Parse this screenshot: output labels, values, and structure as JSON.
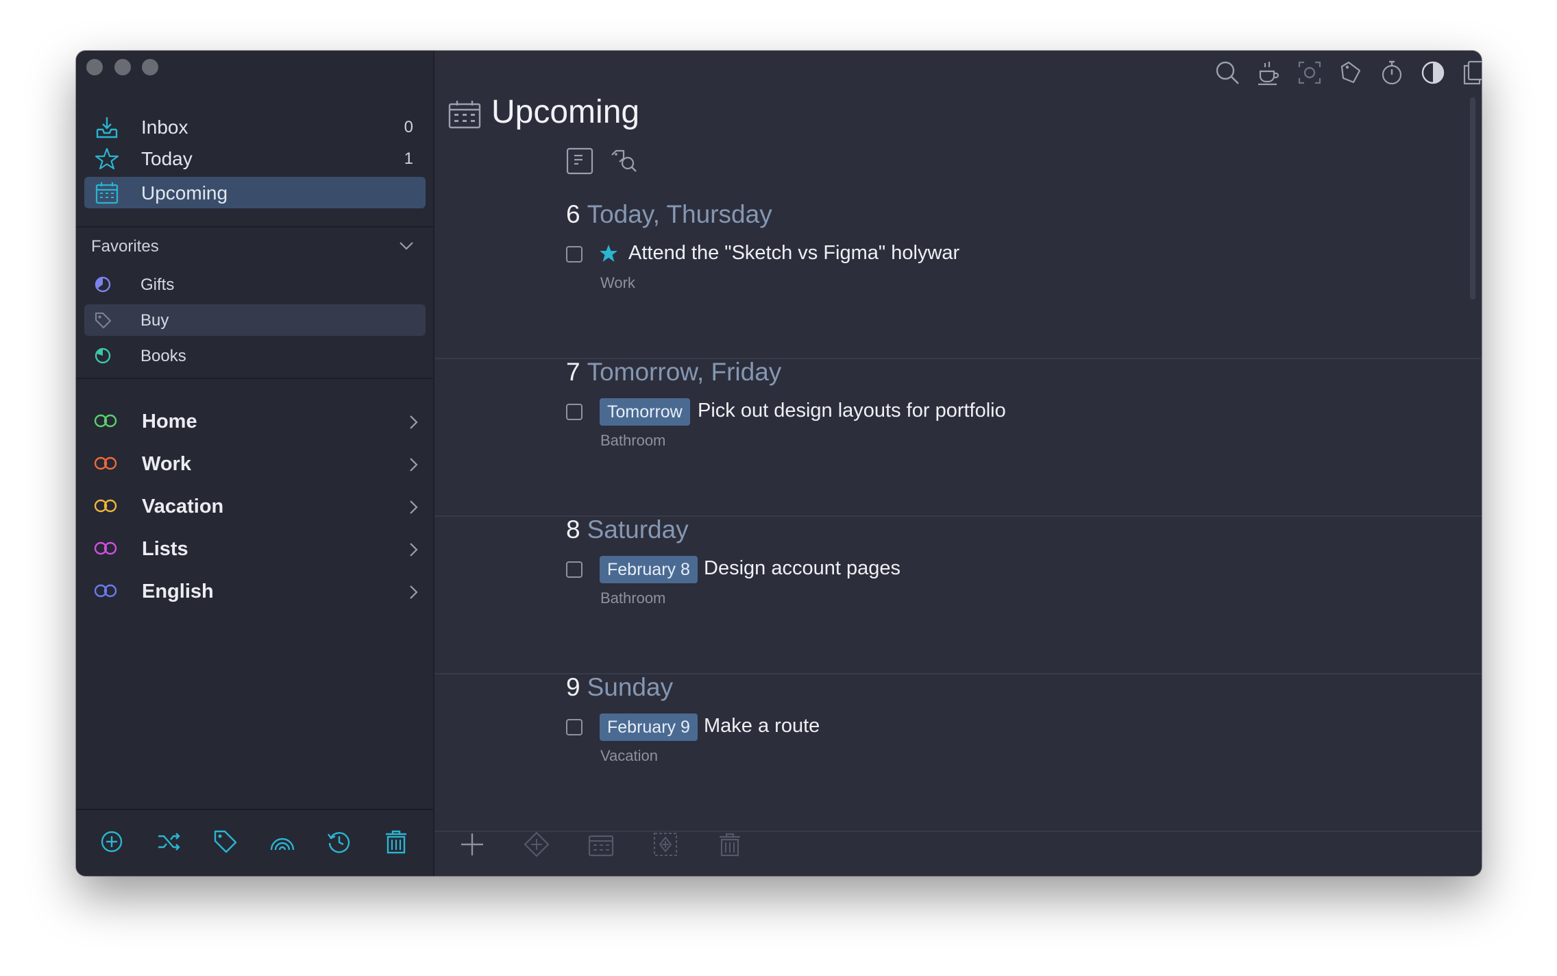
{
  "sidebar": {
    "nav": [
      {
        "label": "Inbox",
        "count": "0",
        "icon": "inbox-tray-icon"
      },
      {
        "label": "Today",
        "count": "1",
        "icon": "star-icon"
      },
      {
        "label": "Upcoming",
        "count": "",
        "icon": "calendar-icon"
      }
    ],
    "favorites_header": "Favorites",
    "favorites": [
      {
        "label": "Gifts",
        "icon": "gifts-circle-icon",
        "color": "#7b83ea"
      },
      {
        "label": "Buy",
        "icon": "tag-icon",
        "color": "#7d8494"
      },
      {
        "label": "Books",
        "icon": "books-circle-icon",
        "color": "#3cc7a8"
      }
    ],
    "projects": [
      {
        "label": "Home",
        "color": "#5bd16b"
      },
      {
        "label": "Work",
        "color": "#f06a3a"
      },
      {
        "label": "Vacation",
        "color": "#f0b53a"
      },
      {
        "label": "Lists",
        "color": "#d24fe0"
      },
      {
        "label": "English",
        "color": "#6a7cf0"
      }
    ],
    "toolbar": [
      "add-icon",
      "shuffle-icon",
      "tag-icon",
      "rainbow-icon",
      "history-icon",
      "trash-icon"
    ]
  },
  "main": {
    "title": "Upcoming",
    "top_tools": [
      "search-icon",
      "coffee-icon",
      "focus-icon",
      "tag-outline-icon",
      "timer-icon",
      "contrast-icon",
      "copy-window-icon"
    ],
    "sections": [
      {
        "num": "6",
        "title": "Today, Thursday",
        "tasks": [
          {
            "badge": "",
            "starred": true,
            "text": "Attend the \"Sketch vs Figma\" holywar",
            "project": "Work"
          }
        ]
      },
      {
        "num": "7",
        "title": "Tomorrow, Friday",
        "tasks": [
          {
            "badge": "Tomorrow",
            "starred": false,
            "text": "Pick out design layouts for portfolio",
            "project": "Bathroom"
          }
        ]
      },
      {
        "num": "8",
        "title": "Saturday",
        "tasks": [
          {
            "badge": "February 8",
            "starred": false,
            "text": "Design account pages",
            "project": "Bathroom"
          }
        ]
      },
      {
        "num": "9",
        "title": "Sunday",
        "tasks": [
          {
            "badge": "February 9",
            "starred": false,
            "text": "Make a route",
            "project": "Vacation"
          }
        ]
      }
    ],
    "bottom_tools": [
      "add-task-icon",
      "tag-diamond-icon",
      "calendar-icon",
      "move-icon",
      "trash-icon",
      "hide-completed-icon"
    ]
  },
  "colors": {
    "accent": "#2ab5d0",
    "selection": "#3a4e6b",
    "badge": "#4a6a92",
    "sidebar_bg": "#262834",
    "main_bg": "#2c2e3b"
  }
}
